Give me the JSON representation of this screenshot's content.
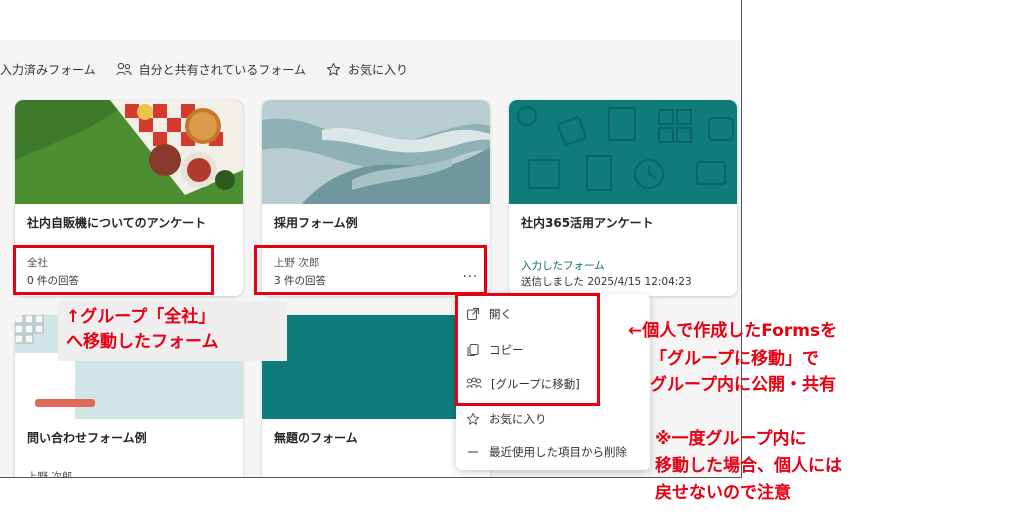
{
  "tabs": [
    {
      "label": "入力済みフォーム",
      "icon": "none"
    },
    {
      "label": "自分と共有されているフォーム",
      "icon": "people-icon"
    },
    {
      "label": "お気に入り",
      "icon": "star-icon"
    }
  ],
  "cards": {
    "card1": {
      "title": "社内自販機についてのアンケート",
      "owner": "全社",
      "responses": "0 件の回答"
    },
    "card2": {
      "title": "採用フォーム例",
      "owner": "上野 次郎",
      "responses": "3 件の回答",
      "more": "···"
    },
    "card3": {
      "title": "社内365活用アンケート",
      "status": "入力したフォーム",
      "timestamp": "送信しました 2025/4/15 12:04:23"
    },
    "card4": {
      "title": "問い合わせフォーム例",
      "owner": "上野 次郎"
    },
    "card5": {
      "title": "無題のフォーム"
    }
  },
  "context_menu": {
    "open": "開く",
    "copy": "コピー",
    "move_to_group": "[グループに移動]",
    "favorite": "お気に入り",
    "remove_recent": "最近使用した項目から削除"
  },
  "annotations": {
    "moved_note_line1": "↑グループ「全社」",
    "moved_note_line2": "へ移動したフォーム",
    "side_line1": "←個人で作成したFormsを",
    "side_line2": "「グループに移動」で",
    "side_line3": "グループ内に公開・共有",
    "warn_line1": "※一度グループ内に",
    "warn_line2": "移動した場合、個人には",
    "warn_line3": "戻せないので注意"
  },
  "colors": {
    "teal": "#0f7b7b",
    "annotation_red": "#e60012",
    "link_teal": "#0f6c6c"
  }
}
